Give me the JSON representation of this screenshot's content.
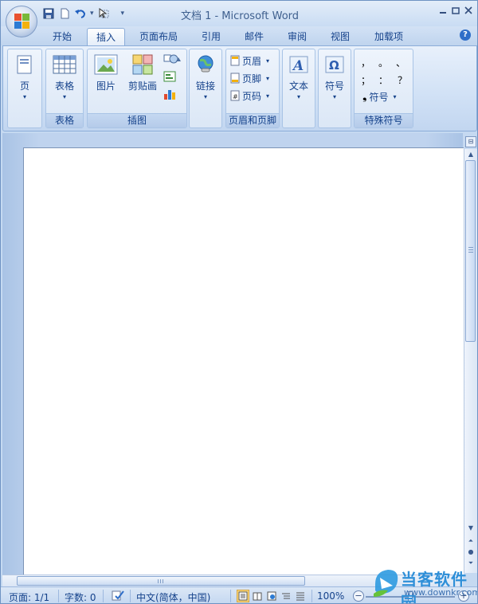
{
  "window": {
    "title": "文档 1 - Microsoft Word",
    "controls": [
      "minimize",
      "restore",
      "close"
    ]
  },
  "quick_access": {
    "items": [
      "save-icon",
      "new-icon",
      "undo-icon",
      "undo-dropdown",
      "select-icon",
      "customize-dropdown"
    ]
  },
  "tabs": [
    {
      "label": "开始"
    },
    {
      "label": "插入",
      "active": true
    },
    {
      "label": "页面布局"
    },
    {
      "label": "引用"
    },
    {
      "label": "邮件"
    },
    {
      "label": "审阅"
    },
    {
      "label": "视图"
    },
    {
      "label": "加载项"
    }
  ],
  "help_label": "?",
  "ribbon": {
    "pages": {
      "button": "页"
    },
    "tables": {
      "button": "表格",
      "group_label": "表格"
    },
    "illustrations": {
      "picture": "图片",
      "clipart": "剪贴画",
      "group_label": "插图"
    },
    "links": {
      "button": "链接"
    },
    "header_footer": {
      "header": "页眉",
      "footer": "页脚",
      "page_number": "页码",
      "group_label": "页眉和页脚"
    },
    "text": {
      "button": "文本"
    },
    "symbols": {
      "button": "符号"
    },
    "special": {
      "chars": [
        "，",
        "。",
        "、",
        "；",
        "：",
        "？"
      ],
      "symbol_button": "符号",
      "group_label": "特殊符号"
    }
  },
  "status": {
    "page": "页面: 1/1",
    "words": "字数: 0",
    "language": "中文(简体，中国)",
    "zoom": "100%",
    "zoom_level_percent": 100
  },
  "watermark": {
    "cn": "当客软件园",
    "en": "www.downkr.com"
  },
  "colors": {
    "ribbon_blue": "#c5d9f1",
    "text_blue": "#15428b",
    "active_view": "#fbd87b"
  }
}
